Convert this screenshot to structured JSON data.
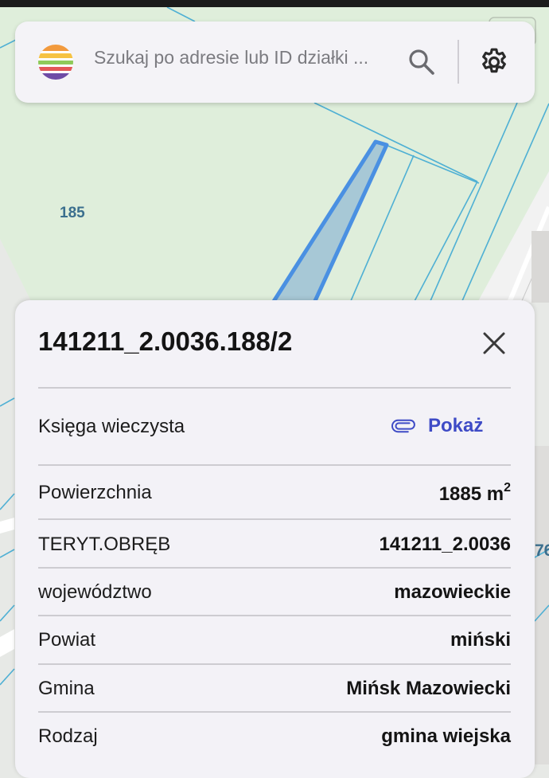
{
  "search": {
    "placeholder": "Szukaj po adresie lub ID działki ..."
  },
  "icons": {
    "logo": "rainbow-stripes-logo",
    "search": "search-icon",
    "settings": "gear-icon",
    "close": "close-icon",
    "attachment": "paperclip-icon"
  },
  "map": {
    "parcel_label_left": "185",
    "parcel_label_edge": "76"
  },
  "panel": {
    "title": "141211_2.0036.188/2",
    "land_registry": {
      "label": "Księga wieczysta",
      "action": "Pokaż"
    },
    "rows": [
      {
        "label": "Powierzchnia",
        "value": "1885 m",
        "unit_sup": "2"
      },
      {
        "label": "TERYT.OBRĘB",
        "value": "141211_2.0036"
      },
      {
        "label": "województwo",
        "value": "mazowieckie"
      },
      {
        "label": "Powiat",
        "value": "miński"
      },
      {
        "label": "Gmina",
        "value": "Mińsk Mazowiecki"
      },
      {
        "label": "Rodzaj",
        "value": "gmina wiejska"
      }
    ]
  },
  "colors": {
    "accent": "#3e4bc6",
    "parcel_highlight": "#4a90e2",
    "map_green": "#dfeedb",
    "map_background": "#e7e9e6"
  }
}
